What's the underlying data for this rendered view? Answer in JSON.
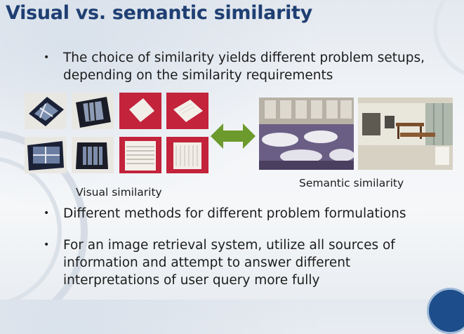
{
  "slide": {
    "title": "Visual vs. semantic similarity",
    "bullets": [
      {
        "marker": "•",
        "lines": [
          "The choice of similarity yields different problem setups,",
          "depending on the similarity requirements"
        ]
      },
      {
        "marker": "•",
        "lines": [
          "Different methods for different problem formulations"
        ]
      },
      {
        "marker": "•",
        "lines": [
          "For an image retrieval system, utilize all sources of",
          "information and attempt to answer different",
          "interpretations of user query more fully"
        ]
      }
    ],
    "captions": {
      "visual": "Visual similarity",
      "semantic": "Semantic similarity"
    },
    "icons": {
      "arrow": "double-headed-arrow-icon",
      "logo": "logo-badge"
    },
    "colors": {
      "title": "#1f3f73",
      "arrow": "#6d9a2c",
      "thumb_red": "#c3233b"
    }
  }
}
